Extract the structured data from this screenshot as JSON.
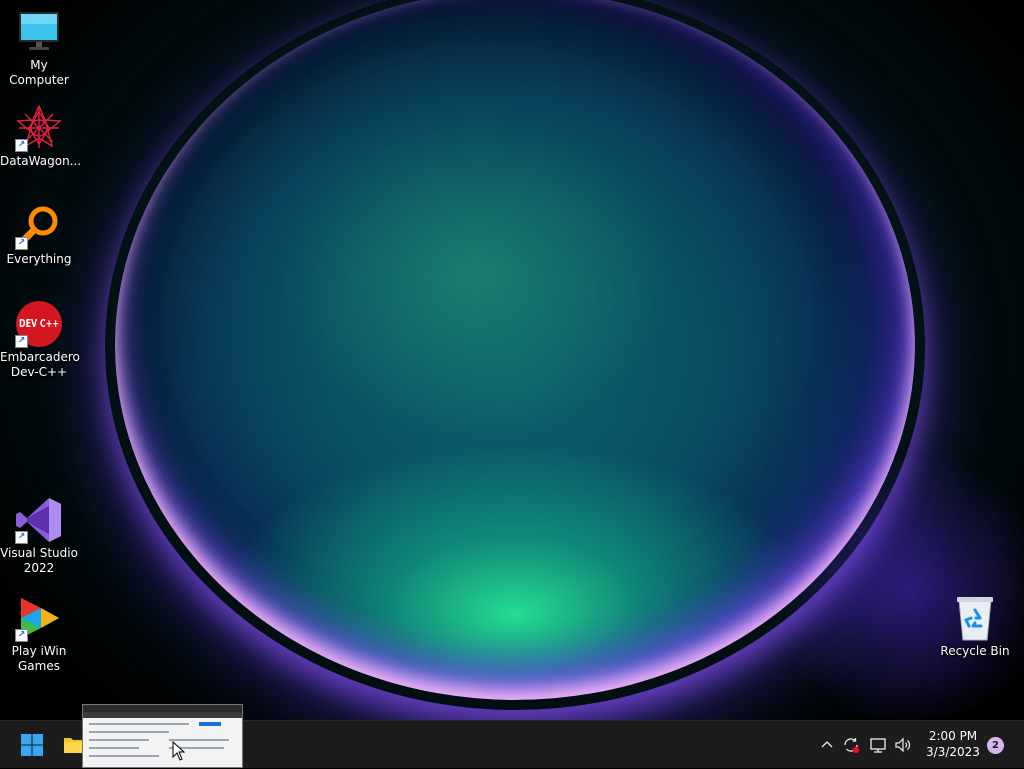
{
  "desktop": {
    "icons": [
      {
        "label": "My Computer"
      },
      {
        "label": "DataWagon..."
      },
      {
        "label": "Everything"
      },
      {
        "label": "Embarcadero Dev-C++"
      },
      {
        "label": "Visual Studio 2022"
      },
      {
        "label": "Play iWin Games"
      },
      {
        "label": "Recycle Bin"
      }
    ]
  },
  "taskbar": {
    "clock": {
      "time": "2:00 PM",
      "date": "3/3/2023"
    },
    "notification_count": "2",
    "devcpp_icon_text": "DEV C++"
  },
  "colors": {
    "taskbar_bg": "#1c1c1c",
    "start_blue": "#3aa6f0",
    "notification_badge": "#d9b5f0"
  }
}
